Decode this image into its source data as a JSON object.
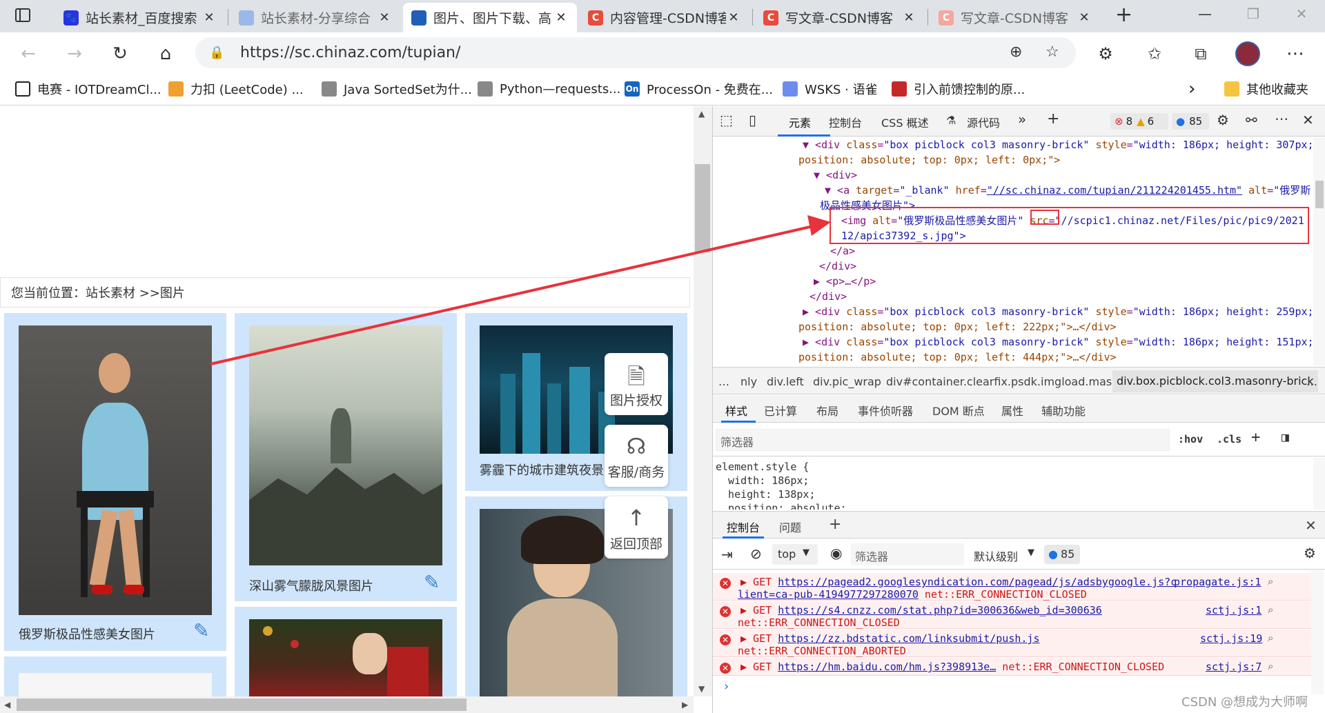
{
  "tabs": [
    {
      "title": "站长素材_百度搜索",
      "close": "✕",
      "fav": "du",
      "color": "#2932e1"
    },
    {
      "title": "站长素材-分享综合",
      "close": "✕",
      "fav": "",
      "color": "#5d8ad6"
    },
    {
      "title": "图片、图片下载、高",
      "close": "✕",
      "fav": "",
      "color": "#1f5fb8"
    },
    {
      "title": "内容管理-CSDN博客",
      "close": "✕",
      "fav": "C",
      "color": "#e94b3c"
    },
    {
      "title": "写文章-CSDN博客",
      "close": "✕",
      "fav": "C",
      "color": "#e94b3c"
    },
    {
      "title": "写文章-CSDN博客",
      "close": "✕",
      "fav": "C",
      "color": "#f3a79f"
    }
  ],
  "new_tab": "+",
  "window": {
    "minimize": "—",
    "restore": "❐",
    "close": "✕"
  },
  "address": {
    "url": "https://sc.chinaz.com/tupian/",
    "lock": "🔒"
  },
  "bookmarks": [
    {
      "label": "电赛 - IOTDreamCl...",
      "color": "#222"
    },
    {
      "label": "力扣 (LeetCode) ...",
      "color": "#f0a030"
    },
    {
      "label": "Java SortedSet为什...",
      "color": "#444"
    },
    {
      "label": "Python—requests...",
      "color": "#444"
    },
    {
      "label": "ProcessOn - 免费在...",
      "color": "#1565c0",
      "icon": "On"
    },
    {
      "label": "WSKS · 语雀",
      "color": "#6b8df0"
    },
    {
      "label": "引入前馈控制的原...",
      "color": "#c62828"
    }
  ],
  "bookmarks_more": "›",
  "other_bookmarks": "其他收藏夹",
  "page": {
    "breadcrumb": "您当前位置：站长素材 >>图片",
    "cards": [
      {
        "caption": "俄罗斯极品性感美女图片"
      },
      {
        "caption": "深山雾气朦胧风景图片"
      },
      {
        "caption": "雾霾下的城市建筑夜景图片"
      }
    ],
    "side_buttons": [
      {
        "label": "图片授权",
        "icon": "🗎"
      },
      {
        "label": "客服/商务",
        "icon": "☊"
      },
      {
        "label": "返回顶部",
        "icon": "↑"
      }
    ]
  },
  "devtools": {
    "tabs": [
      "元素",
      "控制台",
      "CSS 概述",
      "源代码"
    ],
    "active_tab": "元素",
    "badges": {
      "errors": "8",
      "warnings": "6",
      "info": "85"
    },
    "dom_lines": [
      {
        "indent": 0,
        "text_tag": "▼ <div ",
        "a1": "class",
        "v1": "\"box picblock col3 masonry-brick\"",
        "a2": " style",
        "v2": "\"width: 186px; height: 307px;"
      },
      {
        "indent": 0,
        "text": "position: absolute; top: 0px; left: 0px;\">"
      },
      {
        "indent": 1,
        "text": "▼ <div>"
      },
      {
        "indent": 2,
        "text_tag": "▼ <a ",
        "a1": "target",
        "v1": "\"_blank\"",
        "a2": " href",
        "v2": "\"//sc.chinaz.com/tupian/211224201455.htm\"",
        "a3": " alt",
        "v3": "\"俄罗斯"
      },
      {
        "indent": 2,
        "text": "极品性感美女图片\">"
      },
      {
        "indent": 3,
        "text_tag": "<img ",
        "a1": "alt",
        "v1": "\"俄罗斯极品性感美女图片\"",
        "a2": " src",
        "v2": "\"//scpic1.chinaz.net/Files/pic/pic9/2021"
      },
      {
        "indent": 3,
        "text": "12/apic37392_s.jpg\">"
      },
      {
        "indent": 2,
        "text": "</a>"
      },
      {
        "indent": 1,
        "text": "</div>"
      },
      {
        "indent": 1,
        "text": "▶ <p>…</p>"
      },
      {
        "indent": 0,
        "text": "</div>"
      },
      {
        "indent": 0,
        "text_tag": "▶ <div ",
        "a1": "class",
        "v1": "\"box picblock col3 masonry-brick\"",
        "a2": " style",
        "v2": "\"width: 186px; height: 259px;"
      },
      {
        "indent": 0,
        "text": "position: absolute; top: 0px; left: 222px;\">…</div>"
      },
      {
        "indent": 0,
        "text_tag": "▶ <div ",
        "a1": "class",
        "v1": "\"box picblock col3 masonry-brick\"",
        "a2": " style",
        "v2": "\"width: 186px; height: 151px;"
      },
      {
        "indent": 0,
        "text": "position: absolute; top: 0px; left: 444px;\">…</div>"
      }
    ],
    "crumbs": [
      "…",
      "nly",
      "div.left",
      "div.pic_wrap",
      "div#container.clearfix.psdk.imgload.masonry",
      "div.box.picblock.col3.masonry-brick",
      "…"
    ],
    "style_tabs": [
      "样式",
      "已计算",
      "布局",
      "事件侦听器",
      "DOM 断点",
      "属性",
      "辅助功能"
    ],
    "style_filter_placeholder": "筛选器",
    "hov": ":hov",
    "cls": ".cls",
    "style_rules": [
      "element.style {",
      "  width: 186px;",
      "  height: 138px;",
      "  position: absolute;"
    ],
    "drawer_tabs": [
      "控制台",
      "问题"
    ],
    "console": {
      "context": "top",
      "filter_placeholder": "筛选器",
      "level": "默认级别",
      "info_count": "85"
    },
    "errors": [
      {
        "method": "▶ GET ",
        "url": "https://pagead2.googlesyndication.com/pagead/js/adsbygoogle.js?c",
        "url2": "lient=ca-pub-4194977297280070",
        "msg": " net::ERR_CONNECTION_CLOSED",
        "source": "propagate.js:1"
      },
      {
        "method": "▶ GET ",
        "url": "https://s4.cnzz.com/stat.php?id=300636&web_id=300636",
        "url2": "",
        "msg": "net::ERR_CONNECTION_CLOSED",
        "source": "sctj.js:1"
      },
      {
        "method": "▶ GET ",
        "url": "https://zz.bdstatic.com/linksubmit/push.js",
        "url2": "",
        "msg": "net::ERR_CONNECTION_ABORTED",
        "source": "sctj.js:19"
      },
      {
        "method": "▶ GET ",
        "url": "https://hm.baidu.com/hm.js?398913e…",
        "url2": "",
        "msg": " net::ERR_CONNECTION_CLOSED",
        "source": "sctj.js:7"
      }
    ],
    "prompt": "›"
  },
  "watermark": "CSDN @想成为大师啊",
  "colors": {
    "accent": "#1a73e8",
    "card_bg": "#cfe5fb",
    "error_bg": "#fff0f0",
    "annotation": "#e8323c"
  }
}
